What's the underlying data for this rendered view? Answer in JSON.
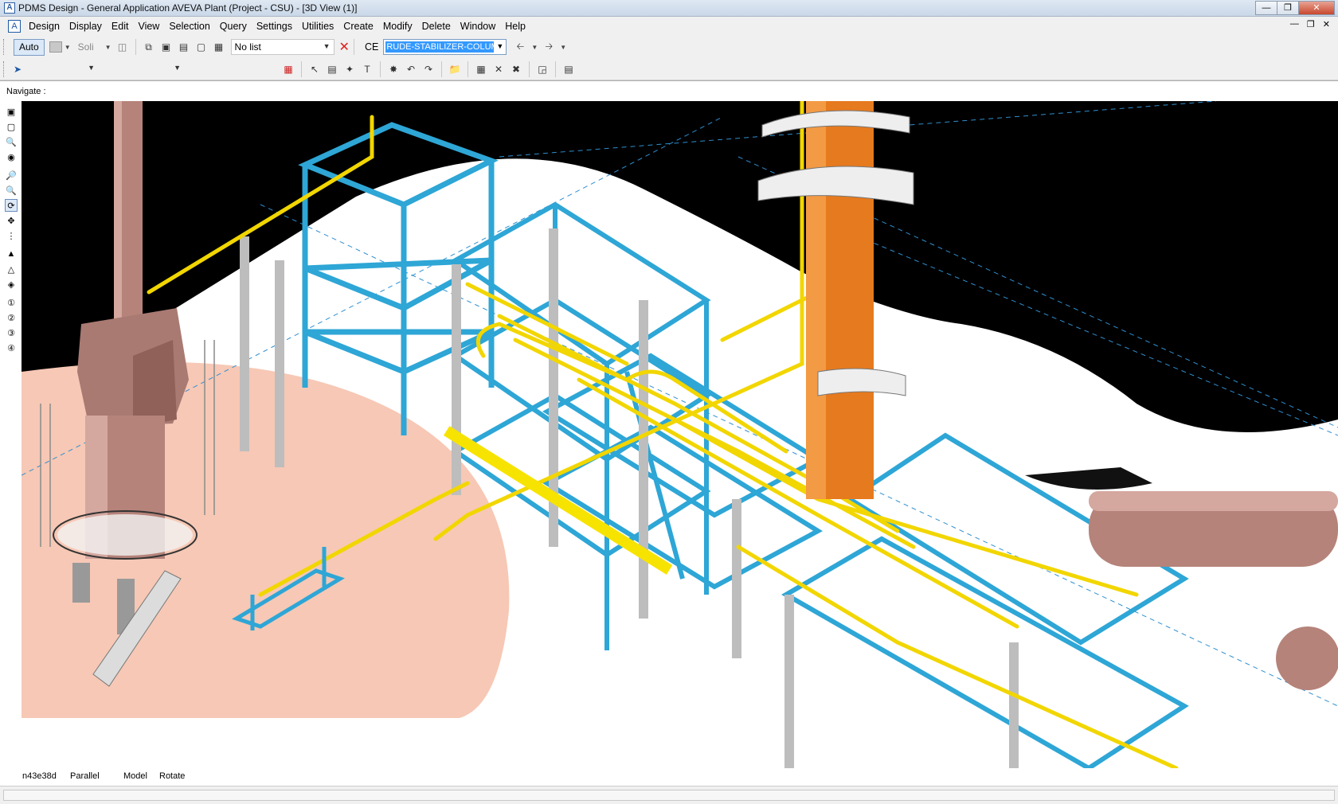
{
  "window": {
    "title": "PDMS Design - General Application  AVEVA Plant (Project - CSU) - [3D View (1)]",
    "app_icon": "pdms-app-icon",
    "controls": [
      "minimize",
      "maximize",
      "close"
    ]
  },
  "menubar": {
    "items": [
      "Design",
      "Display",
      "Edit",
      "View",
      "Selection",
      "Query",
      "Settings",
      "Utilities",
      "Create",
      "Modify",
      "Delete",
      "Window",
      "Help"
    ]
  },
  "toolbar1": {
    "auto_label": "Auto",
    "style_label": "Soli",
    "list_value": "No list",
    "ce_label": "CE",
    "ce_value": "RUDE-STABILIZER-COLUMN"
  },
  "navigate": {
    "label": "Navigate :"
  },
  "status": {
    "element": "n43e38d",
    "projection": "Parallel",
    "mode": "Model",
    "action": "Rotate"
  },
  "colors": {
    "background": "#000000",
    "ground": "#ffffff",
    "pad": "#f5c7b3",
    "steel": "#2ea6d6",
    "pipe": "#f2d600",
    "column": "#e67a1e",
    "stack": "#b5837a",
    "grey_support": "#bdbdbd"
  }
}
